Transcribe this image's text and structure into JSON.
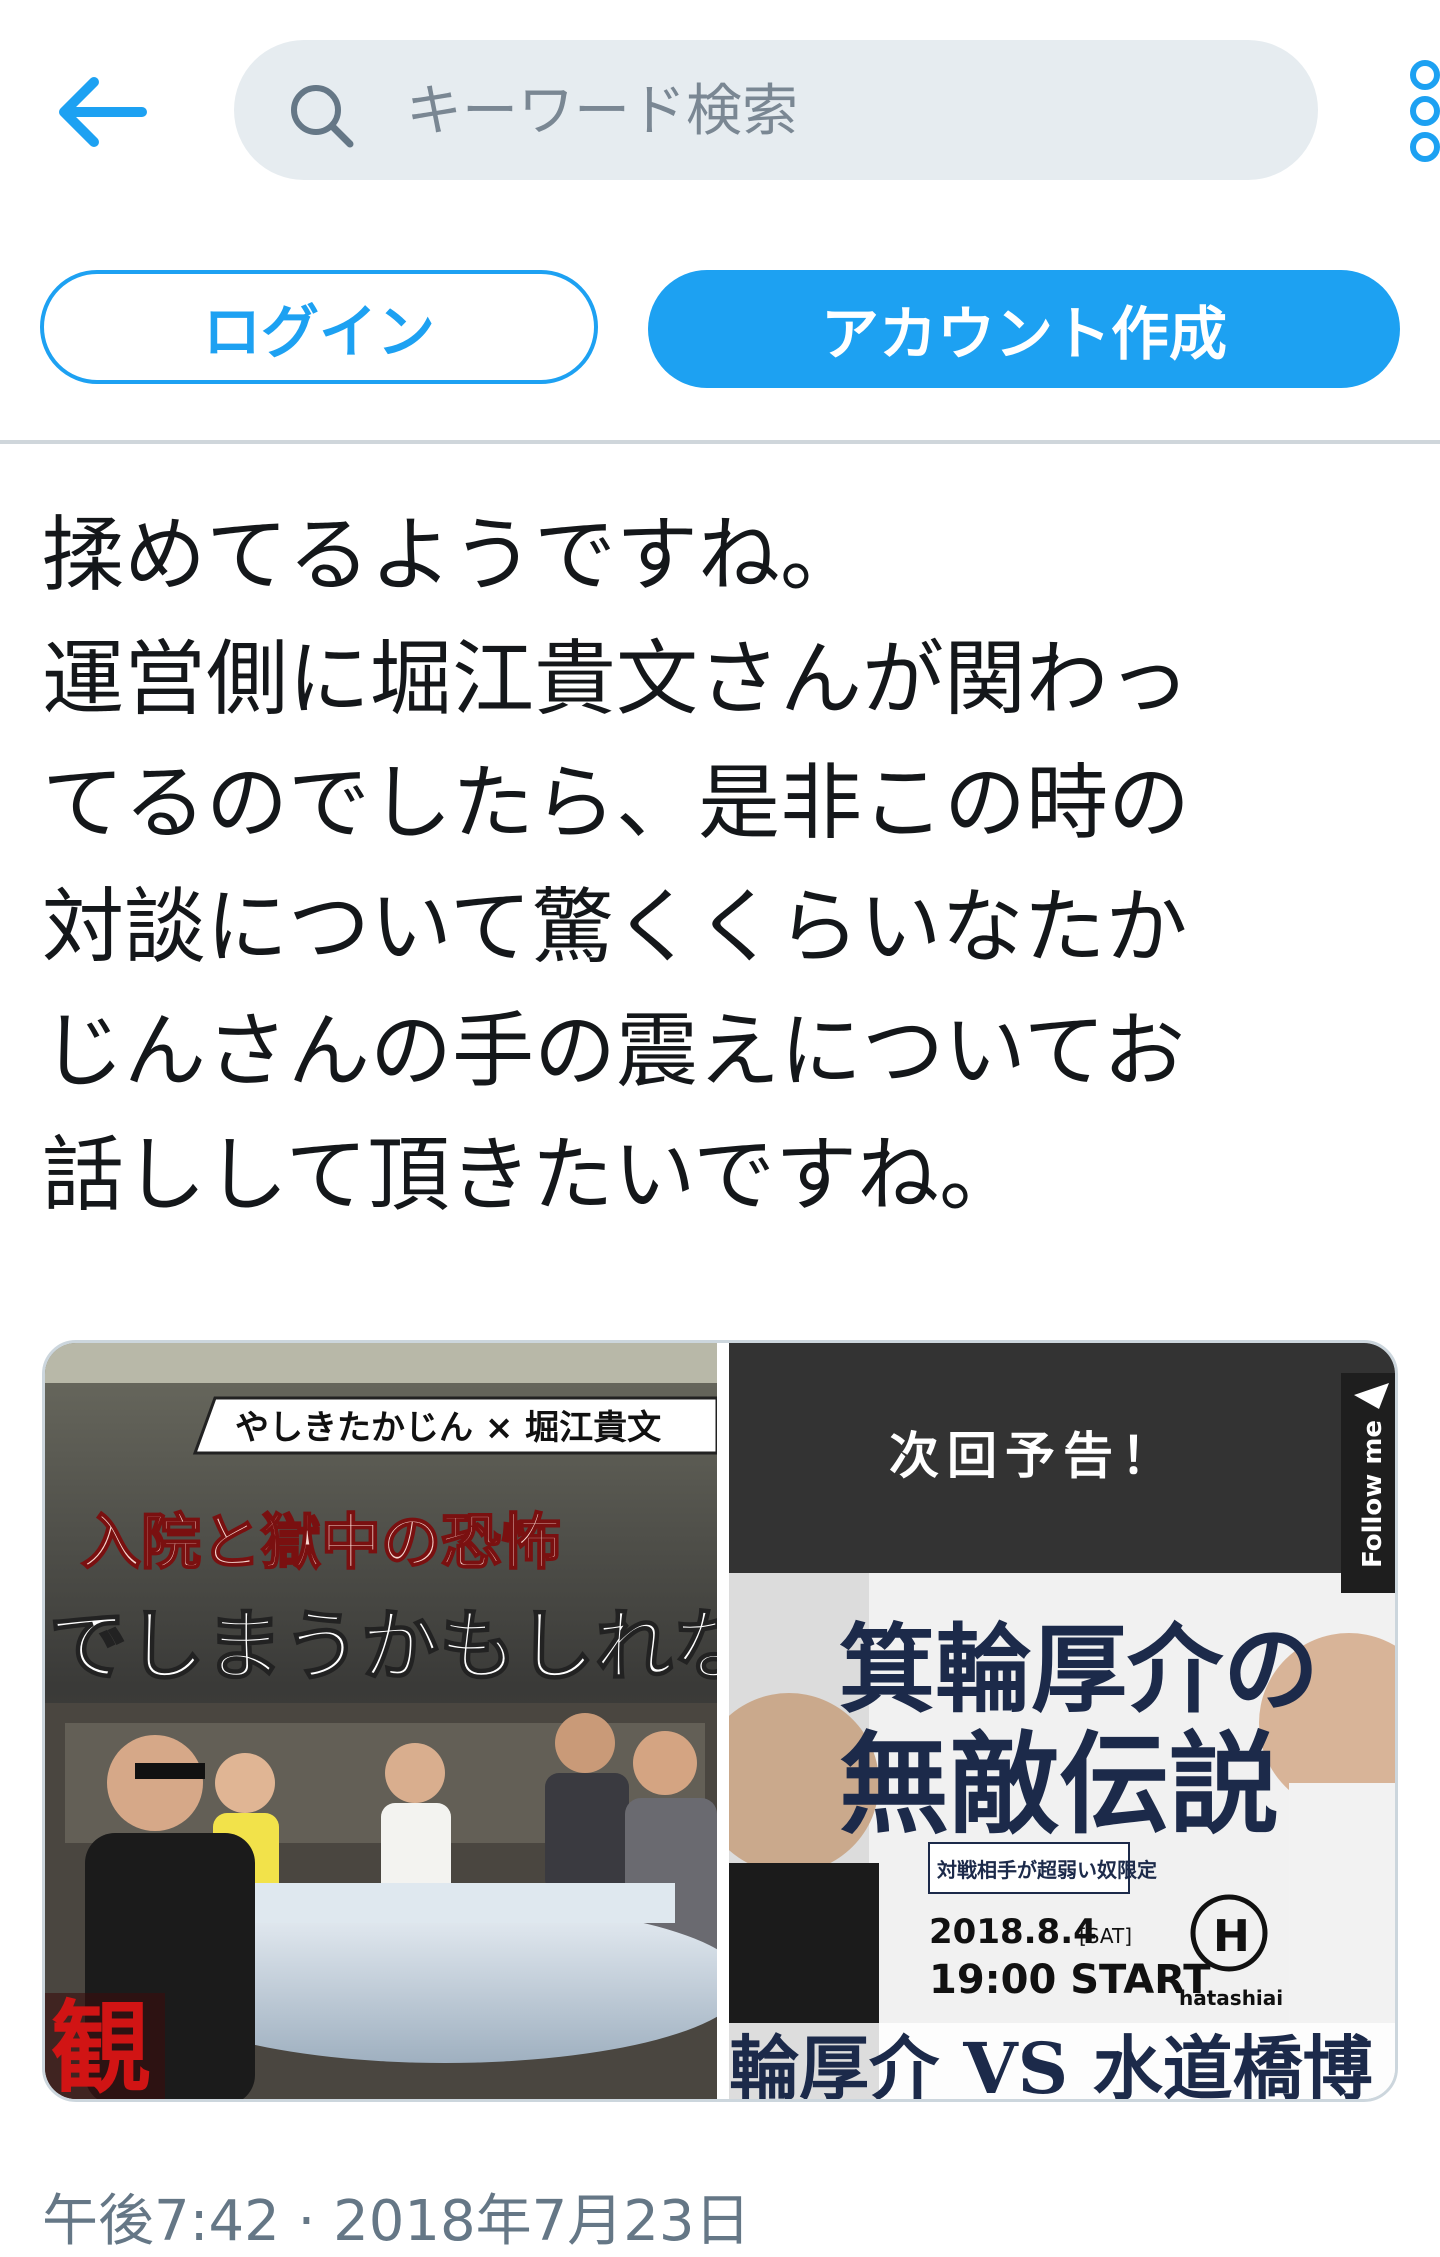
{
  "header": {
    "search_placeholder": "キーワード検索"
  },
  "auth": {
    "login_label": "ログイン",
    "signup_label": "アカウント作成"
  },
  "tweet": {
    "text": "揉めてるようですね。\n運営側に堀江貴文さんが関わっ\nてるのでしたら、是非この時の\n対談について驚くくらいなたか\nじんさんの手の震えについてお\n話しして頂きたいですね。",
    "timestamp": "午後7:42 · 2018年7月23日"
  },
  "media": {
    "left_image": {
      "caption_banner": "やしきたかじん × 堀江貴文",
      "headline_1": "入院と獄中の恐怖",
      "headline_2": "でしまうかもしれない",
      "side_char": "観"
    },
    "right_image": {
      "header": "次回予告！",
      "follow_label": "Follow me",
      "title_line1": "箕輪厚介の",
      "title_line2": "無敵伝説",
      "tag": "対戦相手が超弱い奴限定",
      "date": "2018.8.4",
      "day": "[SAT]",
      "time": "19:00 START",
      "logo_letter": "H",
      "logo_label": "hatashiai",
      "bottom_text": "輪厚介 VS 水道橋博"
    }
  },
  "colors": {
    "accent": "#1da1f2",
    "text": "#14171a",
    "muted": "#657786"
  }
}
